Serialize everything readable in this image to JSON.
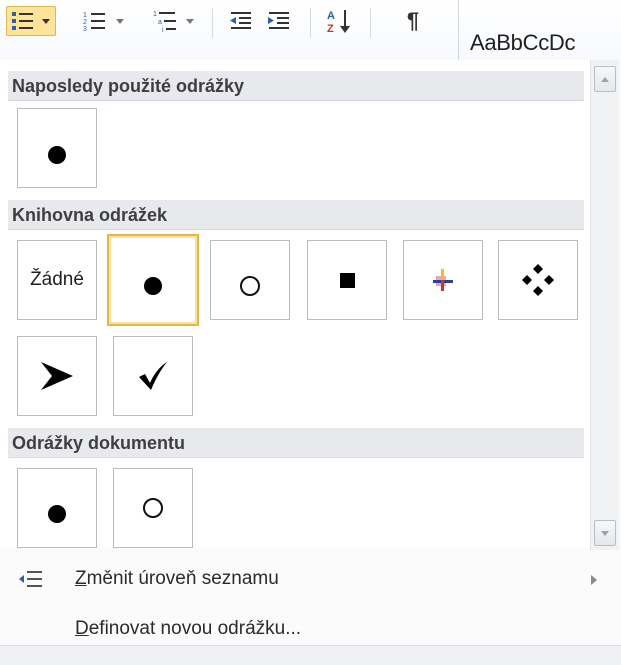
{
  "ribbon": {
    "bullets_button": "bullets",
    "numbering_button": "numbering",
    "multilevel_button": "multilevel list",
    "decrease_indent_button": "decrease indent",
    "increase_indent_button": "increase indent",
    "sort_button": "sort",
    "show_marks_glyph": "¶",
    "styles_preview": "AaBbCcDc"
  },
  "sections": {
    "recent": {
      "header": "Naposledy použité odrážky",
      "items": [
        {
          "symbol": "filled-circle-bullet"
        }
      ]
    },
    "library": {
      "header": "Knihovna odrážek",
      "none_label": "Žádné",
      "items": [
        {
          "symbol": "none"
        },
        {
          "symbol": "filled-circle-bullet",
          "selected": true
        },
        {
          "symbol": "hollow-circle-bullet"
        },
        {
          "symbol": "filled-square-bullet"
        },
        {
          "symbol": "colored-cross-bullet"
        },
        {
          "symbol": "four-diamond-bullet"
        },
        {
          "symbol": "arrowhead-bullet",
          "glyph": "➤"
        },
        {
          "symbol": "checkmark-bullet",
          "glyph": "✓"
        }
      ]
    },
    "document": {
      "header": "Odrážky dokumentu",
      "items": [
        {
          "symbol": "filled-circle-bullet"
        },
        {
          "symbol": "hollow-circle-bullet"
        }
      ]
    }
  },
  "menu": {
    "change_level": {
      "accel": "Z",
      "rest": "měnit úroveň seznamu",
      "icon": "change-list-level-icon"
    },
    "define_new": {
      "accel": "D",
      "rest": "efinovat novou odrážku..."
    }
  },
  "colors": {
    "selected_border": "#e6b547",
    "header_bg": "#e7e9ec"
  }
}
